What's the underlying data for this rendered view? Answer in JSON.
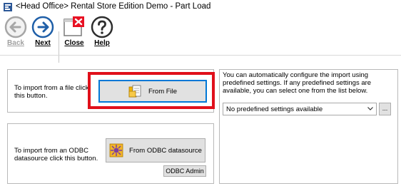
{
  "window": {
    "title": "<Head Office> Rental Store Edition Demo - Part Load"
  },
  "toolbar": {
    "back_label": "Back",
    "next_label": "Next",
    "close_label": "Close",
    "help_label": "Help"
  },
  "file_section": {
    "description": "To import from a file click this button.",
    "button_label": "From File"
  },
  "odbc_section": {
    "description": "To import from an ODBC datasource click this button.",
    "button_label": "From ODBC datasource",
    "admin_label": "ODBC Admin"
  },
  "predefined": {
    "description": "You can automatically configure the import using predefined settings. If any predefined settings are available, you can select one from the list below.",
    "selected_value": "No predefined settings available",
    "browse_label": "..."
  },
  "colors": {
    "accent": "#0078d7",
    "highlight": "#e0101b",
    "close_icon": "#e81123"
  }
}
